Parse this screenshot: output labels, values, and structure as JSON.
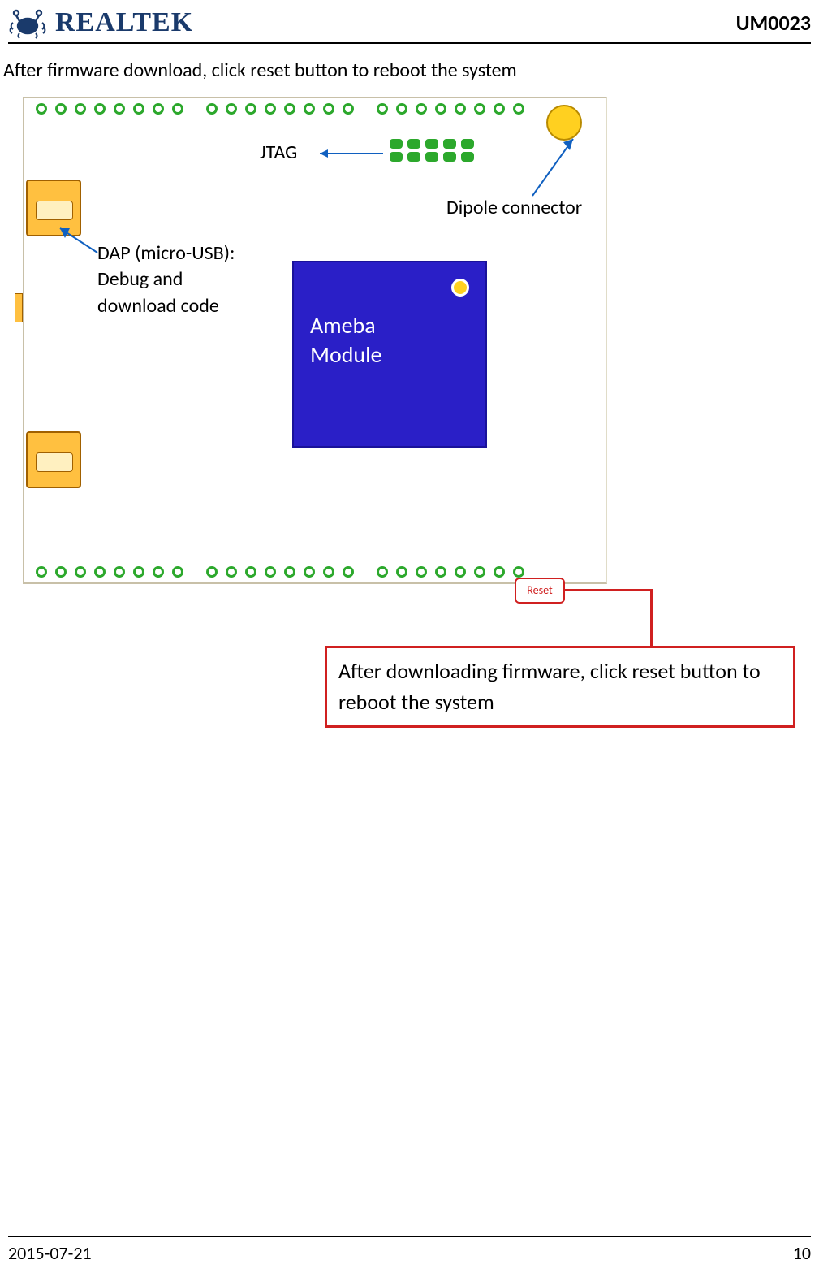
{
  "header": {
    "brand": "REALTEK",
    "doc_id": "UM0023"
  },
  "intro_text": "After firmware download, click reset button to reboot the system",
  "diagram": {
    "jtag_label": "JTAG",
    "dipole_label": "Dipole connector",
    "dap_label": "DAP (micro-USB):\nDebug and\ndownload code",
    "module_label": "Ameba\nModule",
    "reset_label": "Reset",
    "callout_text": "After downloading firmware, click reset button to reboot the system"
  },
  "footer": {
    "date": "2015-07-21",
    "page": "10"
  }
}
